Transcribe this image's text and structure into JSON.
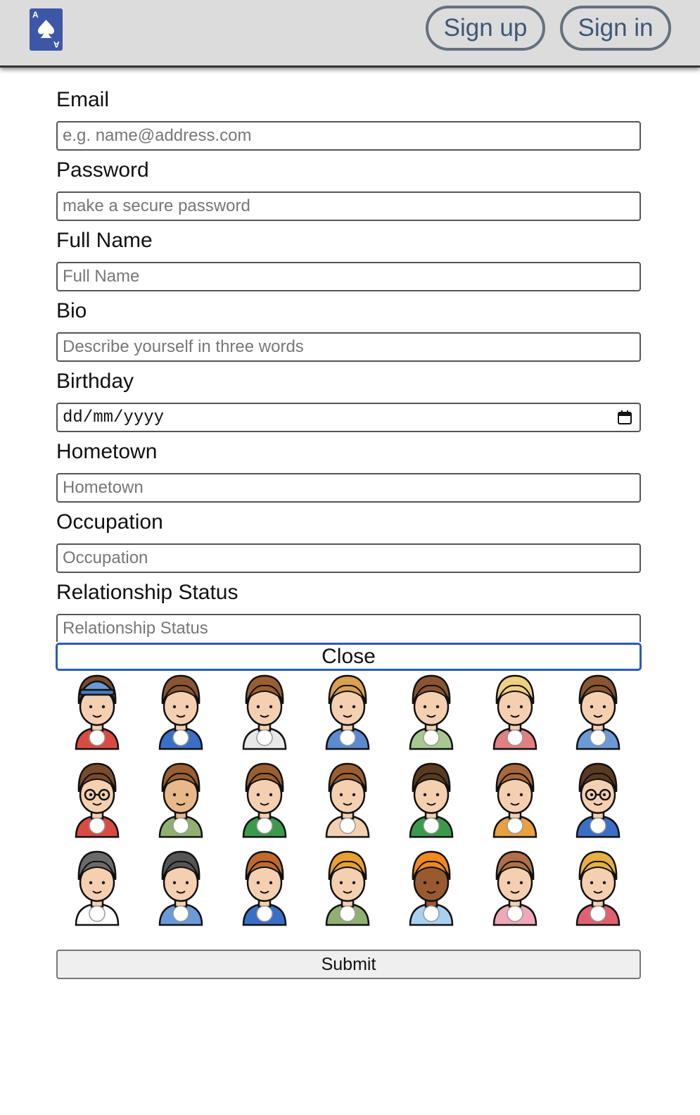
{
  "header": {
    "logo_icon": "ace-of-spades-icon",
    "logo_corner": "A",
    "sign_up_label": "Sign up",
    "sign_in_label": "Sign in",
    "accent": "#3d57a6"
  },
  "form": {
    "fields": [
      {
        "label": "Email",
        "placeholder": "e.g. name@address.com"
      },
      {
        "label": "Password",
        "placeholder": "make a secure password"
      },
      {
        "label": "Full Name",
        "placeholder": "Full Name"
      },
      {
        "label": "Bio",
        "placeholder": "Describe yourself in three words"
      },
      {
        "label": "Birthday",
        "placeholder": "dd/mm/yyyy"
      },
      {
        "label": "Hometown",
        "placeholder": "Hometown"
      },
      {
        "label": "Occupation",
        "placeholder": "Occupation"
      },
      {
        "label": "Relationship Status",
        "placeholder": "Relationship Status"
      }
    ],
    "close_label": "Close",
    "submit_label": "Submit"
  },
  "avatars": [
    {
      "name": "avatar-cap-man",
      "skin": "#f5d0b0",
      "hair": "#7a4a2a",
      "shirt": "#d94b40",
      "extra": "cap"
    },
    {
      "name": "avatar-quiff-man",
      "skin": "#f5d0b0",
      "hair": "#8a5530",
      "shirt": "#3a6fc8"
    },
    {
      "name": "avatar-curly-man",
      "skin": "#f5d0b0",
      "hair": "#9a5e30",
      "shirt": "#e8e8e8"
    },
    {
      "name": "avatar-bun-woman",
      "skin": "#f5d0b0",
      "hair": "#d9a050",
      "shirt": "#5a8ad0"
    },
    {
      "name": "avatar-clip-woman",
      "skin": "#f5d0b0",
      "hair": "#8a5530",
      "shirt": "#a8c890"
    },
    {
      "name": "avatar-blonde-woman",
      "skin": "#f5d0b0",
      "hair": "#f0d080",
      "shirt": "#e08080"
    },
    {
      "name": "avatar-afro-man",
      "skin": "#f5d0b0",
      "hair": "#8a5530",
      "shirt": "#6a9ad8"
    },
    {
      "name": "avatar-bald-beard-man",
      "skin": "#f5d0b0",
      "hair": "#7a4a2a",
      "shirt": "#d94b40",
      "extra": "glasses"
    },
    {
      "name": "avatar-manbun-man",
      "skin": "#e8b888",
      "hair": "#9a5e30",
      "shirt": "#90b070"
    },
    {
      "name": "avatar-bowl-man",
      "skin": "#f5d0b0",
      "hair": "#9a5e30",
      "shirt": "#3a9a4a"
    },
    {
      "name": "avatar-wavy-man",
      "skin": "#f5d0b0",
      "hair": "#9a5e30",
      "shirt": "#f5d0b0"
    },
    {
      "name": "avatar-bald-man",
      "skin": "#f5d0b0",
      "hair": "#5a3a20",
      "shirt": "#3a9a4a"
    },
    {
      "name": "avatar-long-hair-woman",
      "skin": "#f5d0b0",
      "hair": "#a8683a",
      "shirt": "#e8a040"
    },
    {
      "name": "avatar-glasses-man",
      "skin": "#f5d0b0",
      "hair": "#5a3a20",
      "shirt": "#3a6fc8",
      "extra": "glasses"
    },
    {
      "name": "avatar-ponytail-woman",
      "skin": "#f5d0b0",
      "hair": "#6a6a6a",
      "shirt": "#ffffff"
    },
    {
      "name": "avatar-dark-hair-woman",
      "skin": "#f5d0b0",
      "hair": "#555555",
      "shirt": "#6a9ad8"
    },
    {
      "name": "avatar-mustache-man",
      "skin": "#f5d0b0",
      "hair": "#c06a30",
      "shirt": "#3a6fc8"
    },
    {
      "name": "avatar-side-part-woman",
      "skin": "#f5d0b0",
      "hair": "#e8a030",
      "shirt": "#90b070"
    },
    {
      "name": "avatar-redhead-woman",
      "skin": "#9a5a30",
      "hair": "#f08a20",
      "shirt": "#a8d0f0"
    },
    {
      "name": "avatar-brunette-woman",
      "skin": "#f5d0b0",
      "hair": "#b0704a",
      "shirt": "#f0a8b8"
    },
    {
      "name": "avatar-wavy-blonde-woman",
      "skin": "#f5d0b0",
      "hair": "#e8b040",
      "shirt": "#e06070"
    }
  ]
}
